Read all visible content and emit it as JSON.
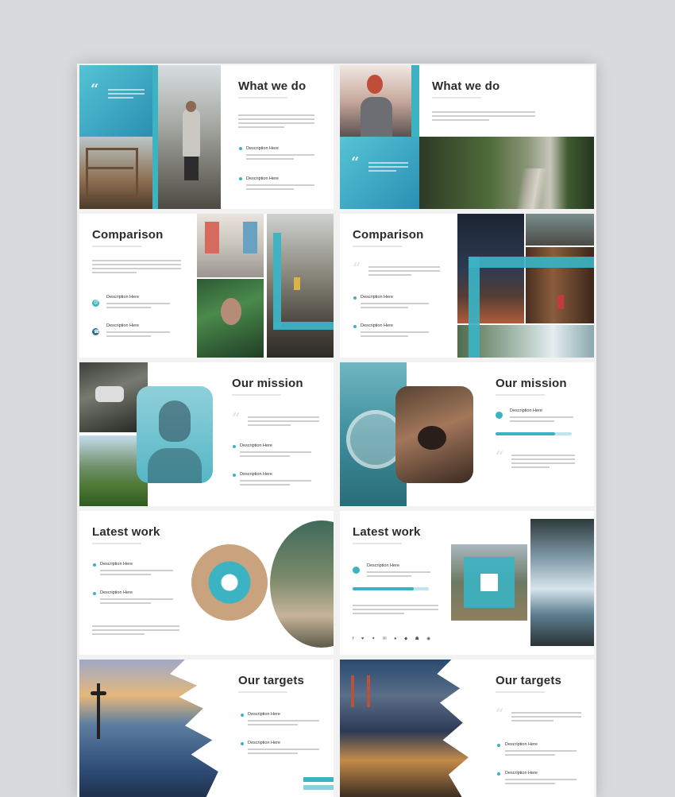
{
  "accent": "#3bb3c3",
  "slides": {
    "what_we_do": "What we do",
    "comparison": "Comparison",
    "our_mission": "Our mission",
    "latest_work": "Latest work",
    "our_targets": "Our targets",
    "description": "Description Here"
  },
  "icons": {
    "quote": "“",
    "email": "@",
    "phone": "☎",
    "social": "f ♥ ✦ ✉ ● ◆ ☗ ◉"
  }
}
